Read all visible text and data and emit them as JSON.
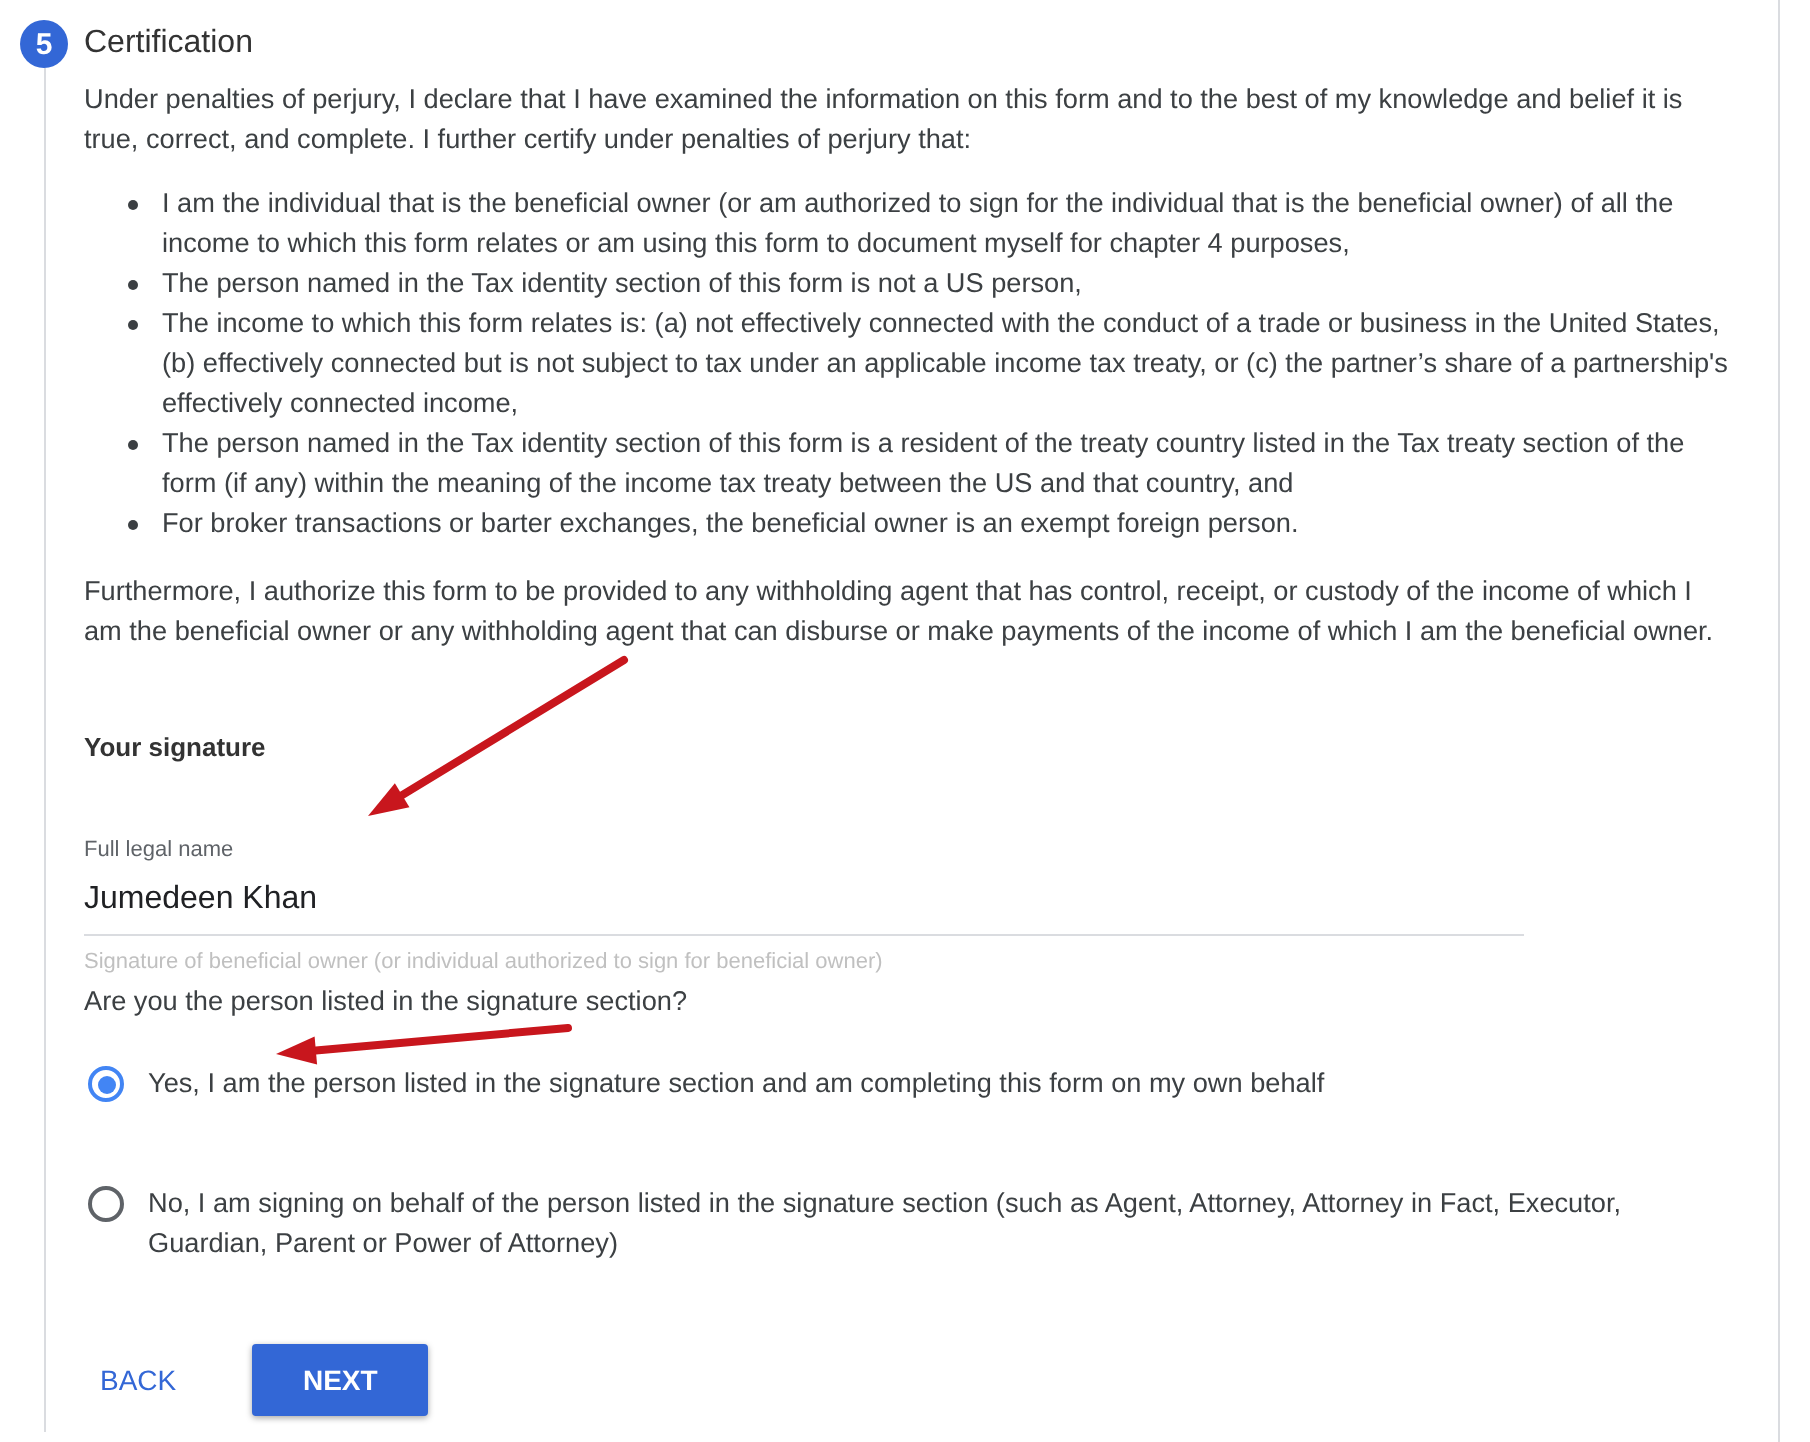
{
  "step": {
    "number": "5",
    "title": "Certification"
  },
  "intro": "Under penalties of perjury, I declare that I have examined the information on this form and to the best of my knowledge and belief it is true, correct, and complete. I further certify under penalties of perjury that:",
  "certifications": [
    "I am the individual that is the beneficial owner (or am authorized to sign for the individual that is the beneficial owner) of all the income to which this form relates or am using this form to document myself for chapter 4 purposes,",
    "The person named in the Tax identity section of this form is not a US person,",
    "The income to which this form relates is: (a) not effectively connected with the conduct of a trade or business in the United States, (b) effectively connected but is not subject to tax under an applicable income tax treaty, or (c) the partner’s share of a partnership's effectively connected income,",
    "The person named in the Tax identity section of this form is a resident of the treaty country listed in the Tax treaty section of the form (if any) within the meaning of the income tax treaty between the US and that country, and",
    "For broker transactions or barter exchanges, the beneficial owner is an exempt foreign person."
  ],
  "authorization": "Furthermore, I authorize this form to be provided to any withholding agent that has control, receipt, or custody of the income of which I am the beneficial owner or any withholding agent that can disburse or make payments of the income of which I am the beneficial owner.",
  "signature": {
    "heading": "Your signature",
    "label": "Full legal name",
    "value": "Jumedeen Khan",
    "helper": "Signature of beneficial owner (or individual authorized to sign for beneficial owner)"
  },
  "question": "Are you the person listed in the signature section?",
  "options": [
    {
      "label": "Yes, I am the person listed in the signature section and am completing this form on my own behalf",
      "selected": true
    },
    {
      "label": "No, I am signing on behalf of the person listed in the signature section (such as Agent, Attorney, Attorney in Fact, Executor, Guardian, Parent or Power of Attorney)",
      "selected": false
    }
  ],
  "buttons": [
    {
      "label": "BACK",
      "kind": "text"
    },
    {
      "label": "NEXT",
      "kind": "primary"
    }
  ],
  "annotations": [
    {
      "kind": "arrow"
    },
    {
      "kind": "arrow"
    }
  ]
}
